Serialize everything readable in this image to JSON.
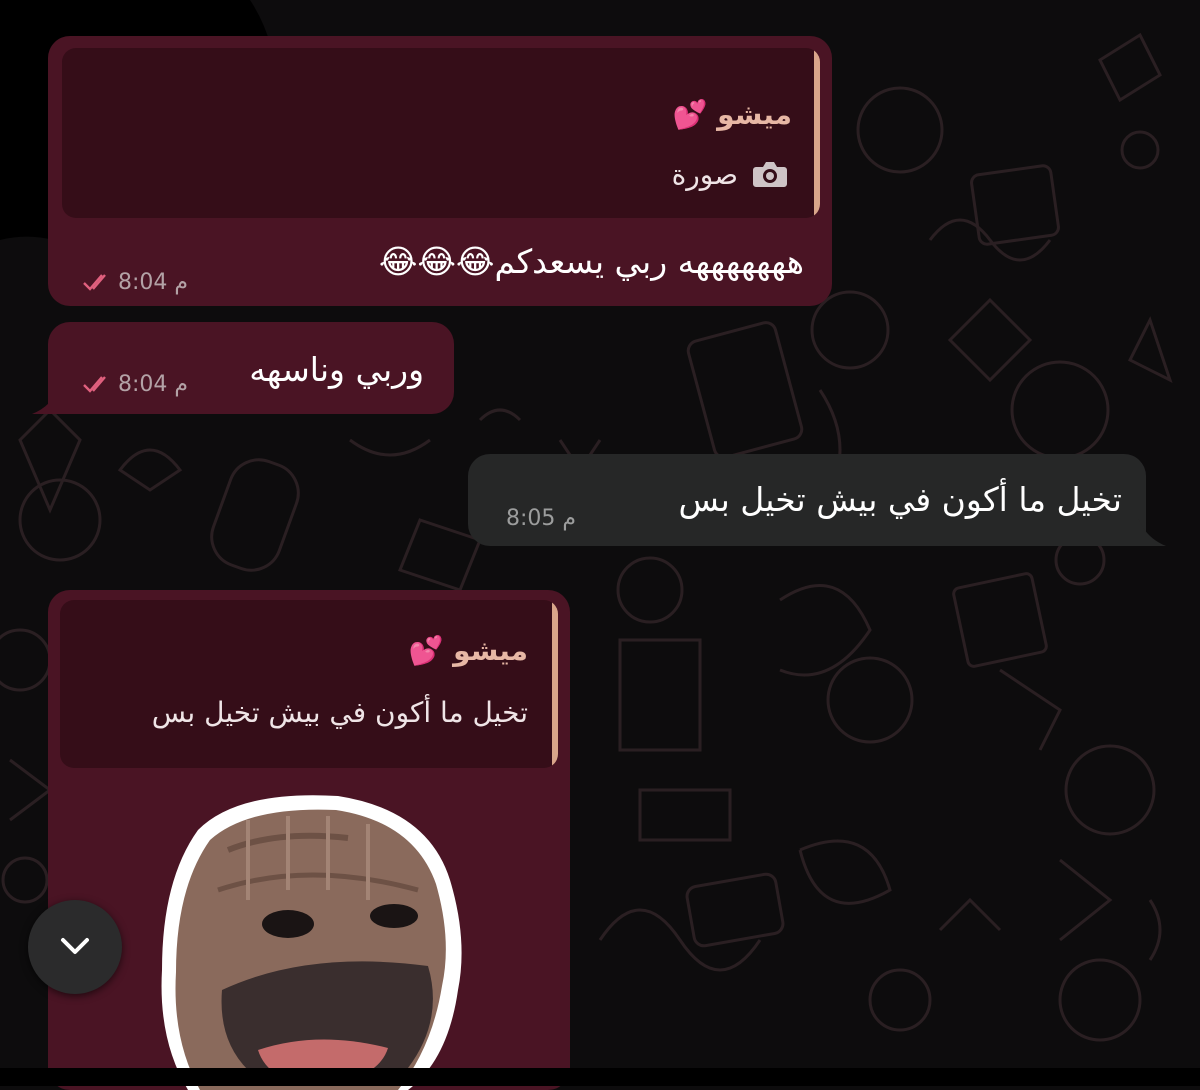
{
  "colors": {
    "background": "#0d0c0d",
    "incoming_bubble": "#4a1424",
    "outgoing_bubble": "#262727",
    "quote_bar": "#d9a58a",
    "sender_name": "#e7b7a5",
    "read_ticks": "#e0607e"
  },
  "messages": [
    {
      "direction": "incoming",
      "reply_to": {
        "sender": "ميشو 💕",
        "preview_icon": "camera-icon",
        "preview_text": "صورة"
      },
      "text": "هههههههه ربي يسعدكم😂😂😂",
      "time": "8:04 م",
      "status": "read"
    },
    {
      "direction": "incoming",
      "text": "وربي وناسهه",
      "time": "8:04 م",
      "status": "read"
    },
    {
      "direction": "outgoing",
      "text": "تخيل ما أكون في بيش تخيل بس",
      "time": "8:05 م"
    },
    {
      "direction": "incoming",
      "reply_to": {
        "sender": "ميشو 💕",
        "preview_text": "تخيل ما أكون في بيش تخيل بس"
      },
      "sticker": "knitted-doll-sticker"
    }
  ],
  "scroll_button": {
    "icon": "chevron-down-icon"
  }
}
